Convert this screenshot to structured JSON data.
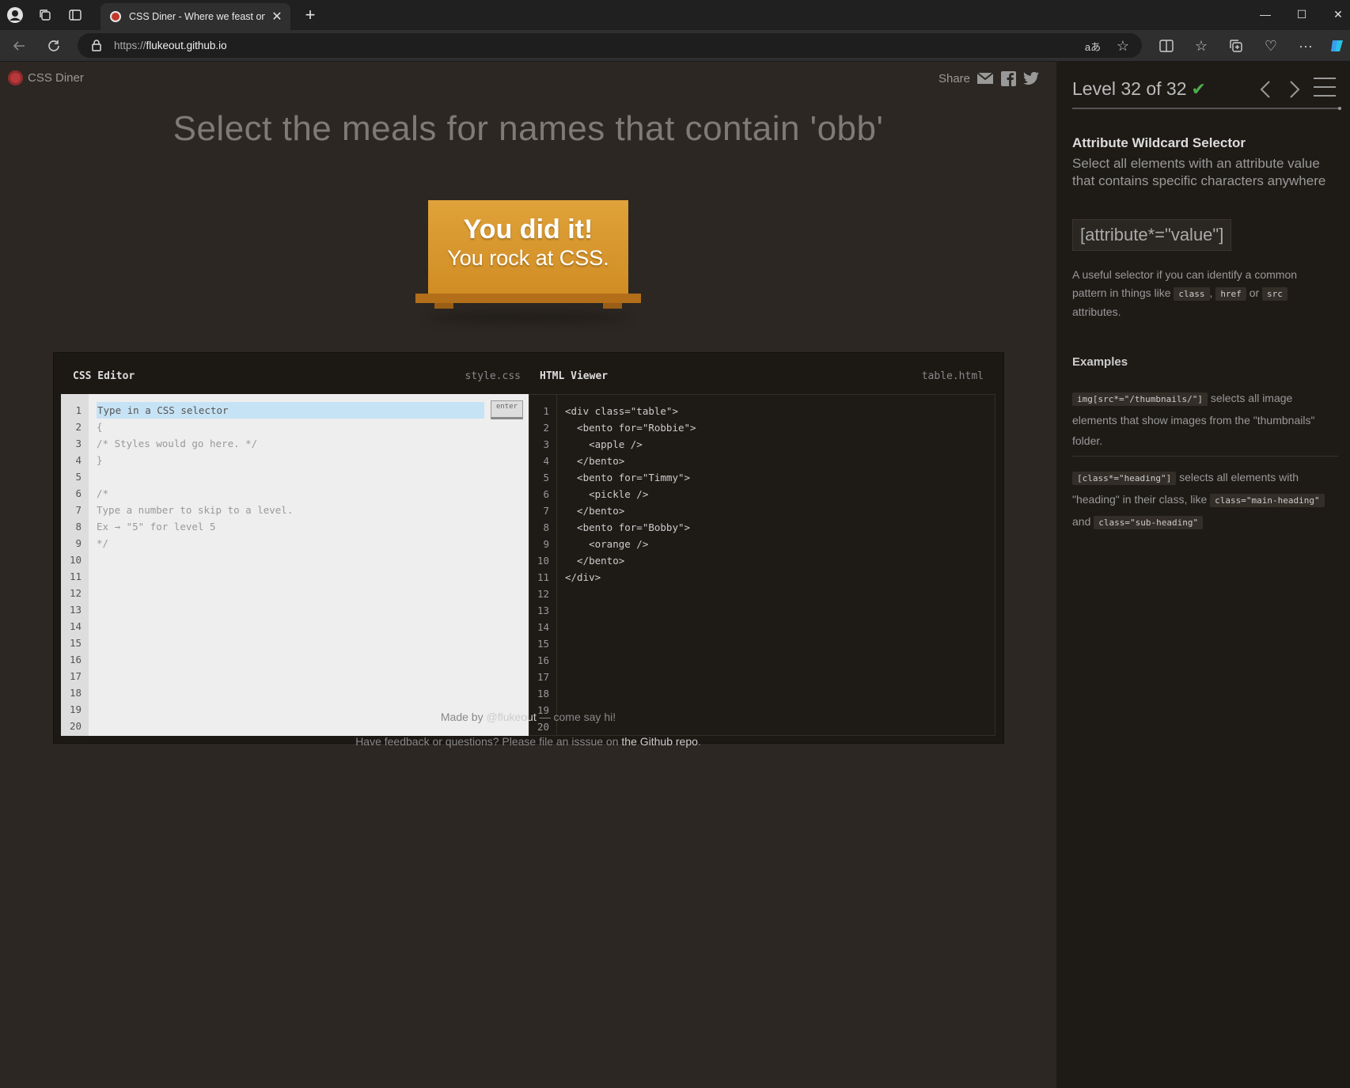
{
  "browser": {
    "tab_title": "CSS Diner - Where we feast on CSS",
    "url_scheme": "https://",
    "url_host": "flukeout.github.io"
  },
  "header": {
    "logo_text": "CSS Diner",
    "share_label": "Share"
  },
  "main": {
    "order_title": "Select the meals for names that contain 'obb'",
    "win_line_1": "You did it!",
    "win_line_2": "You rock at CSS."
  },
  "css_editor": {
    "title": "CSS Editor",
    "filename": "style.css",
    "input_placeholder": "Type in a CSS selector",
    "enter_label": "enter",
    "lines": [
      "",
      "{",
      "/* Styles would go here. */",
      "}",
      "",
      "/*",
      "Type a number to skip to a level.",
      "Ex → \"5\" for level 5",
      "*/"
    ],
    "line_numbers": [
      "1",
      "2",
      "3",
      "4",
      "5",
      "6",
      "7",
      "8",
      "9",
      "10",
      "11",
      "12",
      "13",
      "14",
      "15",
      "16",
      "17",
      "18",
      "19",
      "20"
    ]
  },
  "html_viewer": {
    "title": "HTML Viewer",
    "filename": "table.html",
    "lines": [
      "<div class=\"table\">",
      "  <bento for=\"Robbie\">",
      "    <apple />",
      "  </bento>",
      "  <bento for=\"Timmy\">",
      "    <pickle />",
      "  </bento>",
      "  <bento for=\"Bobby\">",
      "    <orange />",
      "  </bento>",
      "</div>"
    ],
    "line_numbers": [
      "1",
      "2",
      "3",
      "4",
      "5",
      "6",
      "7",
      "8",
      "9",
      "10",
      "11",
      "12",
      "13",
      "14",
      "15",
      "16",
      "17",
      "18",
      "19",
      "20"
    ]
  },
  "footer": {
    "made_by_prefix": "Made by ",
    "made_by_link": "@flukeout",
    "made_by_suffix": " — come say hi!",
    "feedback_prefix": "Have feedback or questions? Please file an isssue on ",
    "feedback_link": "the Github repo",
    "feedback_suffix": "."
  },
  "sidebar": {
    "level_label": "Level 32 of 32",
    "progress_fraction": 1.0,
    "selector_name": "Attribute Wildcard Selector",
    "selector_desc": "Select all elements with an attribute value that contains specific characters anywhere",
    "syntax": "[attribute*=\"value\"]",
    "help_prefix": "A useful selector if you can identify a common pattern in things like ",
    "help_code_1": "class",
    "help_sep_1": ", ",
    "help_code_2": "href",
    "help_sep_2": " or ",
    "help_code_3": "src",
    "help_suffix": " attributes.",
    "examples_title": "Examples",
    "example_1_code": "img[src*=\"/thumbnails/\"]",
    "example_1_text": " selects all image elements that show images from the \"thumbnails\" folder.",
    "example_2_code": "[class*=\"heading\"]",
    "example_2_text_1": " selects all elements with \"heading\" in their class, like ",
    "example_2_code_2": "class=\"main-heading\"",
    "example_2_text_2": " and ",
    "example_2_code_3": "class=\"sub-heading\""
  },
  "colors": {
    "page_bg": "#2c2722",
    "sidebar_bg": "#1e1b17",
    "table_orange": "#d99530",
    "check_green": "#4cae4c",
    "input_highlight": "#c6e3f5"
  }
}
